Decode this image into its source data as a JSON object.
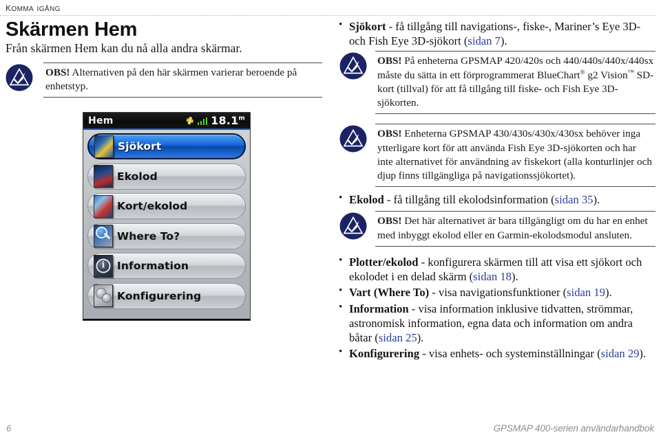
{
  "header": {
    "running_head": "Komma igång"
  },
  "title": "Skärmen Hem",
  "subtitle": "Från skärmen Hem kan du nå alla andra skärmar.",
  "notes": {
    "left_note": {
      "label": "OBS!",
      "text": " Alternativen på den här skärmen varierar beroende på enhetstyp."
    },
    "chart_note": {
      "label": "OBS!",
      "text_part1": " På enheterna GPSMAP 420/420s och 440/440s/440x/440sx måste du sätta in ett förprogrammerat BlueChart",
      "sym1": "®",
      "text_part2": " g2 Vision",
      "sym2": "™",
      "text_part3": " SD-kort (tillval) för att få tillgång till fiske- och Fish Eye 3D-sjökorten."
    },
    "fisheye_note": {
      "label": "OBS!",
      "text": " Enheterna GPSMAP 430/430s/430x/430sx behöver inga ytterligare kort för att använda Fish Eye 3D-sjökorten och har inte alternativet för användning av fiskekort (alla konturlinjer och djup finns tillgängliga på navigationssjökortet)."
    },
    "sonar_note": {
      "label": "OBS!",
      "text": " Det här alternativet är bara tillgängligt om du har en enhet med inbyggt ekolod eller en Garmin-ekolodsmodul ansluten."
    }
  },
  "device": {
    "title": "Hem",
    "depth_value": "18.1",
    "depth_unit": "m",
    "signal_icon": "satellite-signal-icon",
    "menu_items": [
      {
        "label": "Sjökort",
        "icon": "chart-icon",
        "selected": true
      },
      {
        "label": "Ekolod",
        "icon": "sonar-icon",
        "selected": false
      },
      {
        "label": "Kort/ekolod",
        "icon": "split-icon",
        "selected": false
      },
      {
        "label": "Where To?",
        "icon": "where-to-icon",
        "selected": false
      },
      {
        "label": "Information",
        "icon": "information-icon",
        "selected": false
      },
      {
        "label": "Konfigurering",
        "icon": "config-icon",
        "selected": false
      }
    ]
  },
  "bullets": {
    "chart": {
      "term": "Sjökort",
      "text_before": " - få tillgång till navigations-, fiske-, Mariner’s Eye 3D- och Fish Eye 3D-sjökort (",
      "xref": "sidan 7",
      "text_after": ")."
    },
    "sonar": {
      "term": "Ekolod",
      "text_before": " - få tillgång till ekolodsinformation (",
      "xref": "sidan 35",
      "text_after": ")."
    },
    "chartsonar": {
      "term": "Plotter/ekolod",
      "text_before": " - konfigurera skärmen till att visa ett sjökort och ekolodet i en delad skärm (",
      "xref": "sidan 18",
      "text_after": ")."
    },
    "whereto": {
      "term": "Vart (Where To)",
      "text_before": " - visa navigationsfunktioner (",
      "xref": "sidan 19",
      "text_after": ")."
    },
    "information": {
      "term": "Information",
      "text_before": " - visa information inklusive tidvatten, strömmar, astronomisk information, egna data och information om andra båtar (",
      "xref": "sidan 25",
      "text_after": ")."
    },
    "configure": {
      "term": "Konfigurering",
      "text_before": " - visa enhets- och systeminställningar (",
      "xref": "sidan 29",
      "text_after": ")."
    }
  },
  "footer": {
    "page_number": "6",
    "manual_title": "GPSMAP 400-serien användarhandbok"
  },
  "colors": {
    "note_icon_blue": "#1b2365",
    "xref_blue": "#2b3f9e",
    "selected_item_blue": "#1664d8",
    "footer_gray": "#8e8e8e"
  }
}
